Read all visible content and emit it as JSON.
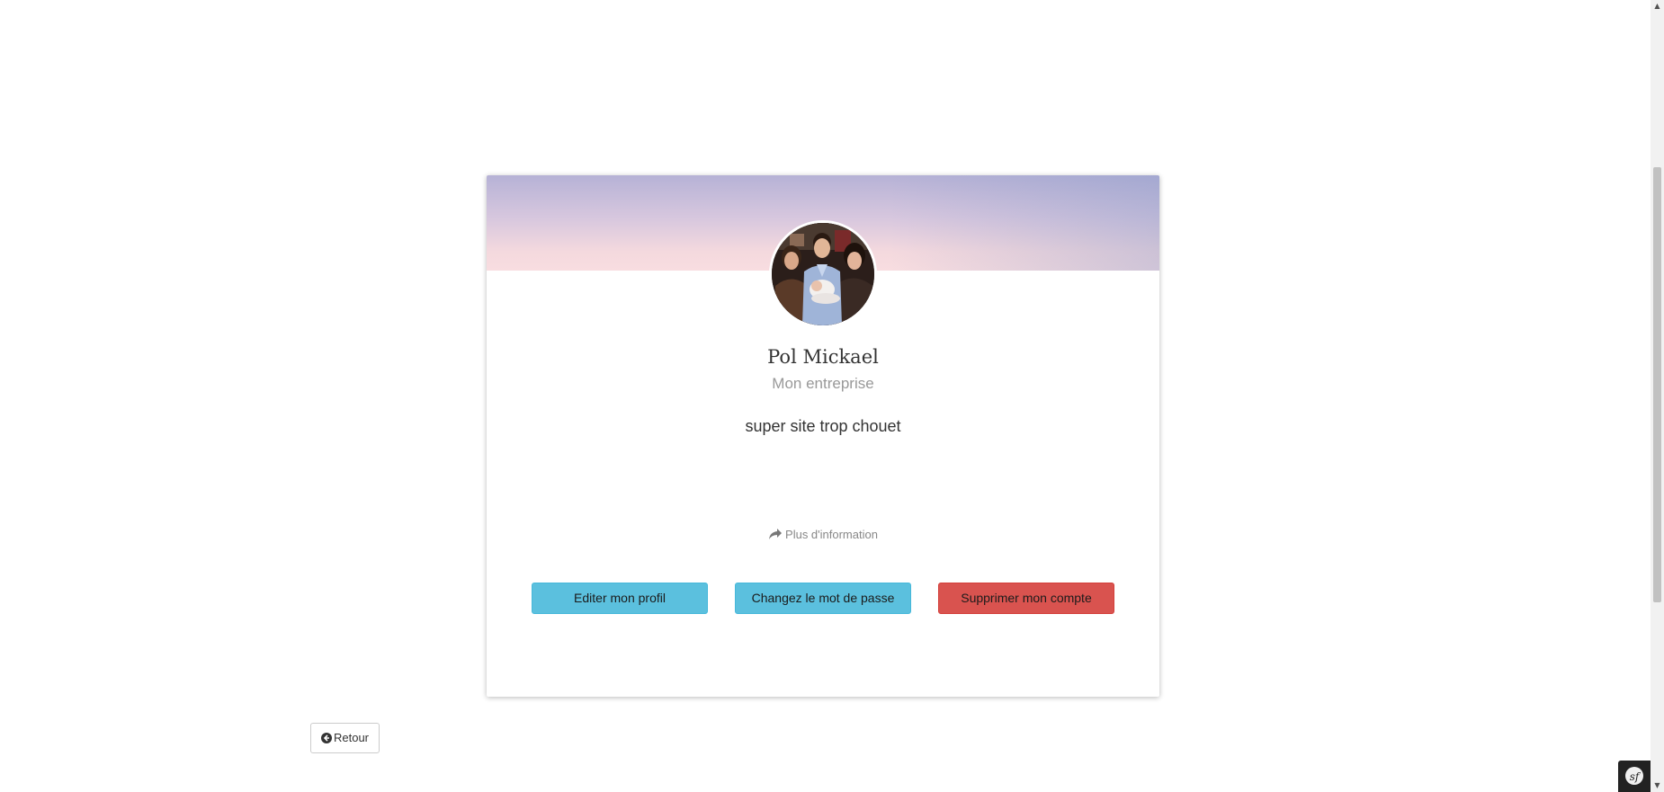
{
  "profile": {
    "name": "Pol Mickael",
    "company": "Mon entreprise",
    "bio": "super site trop chouet",
    "more_info_label": "Plus d'information"
  },
  "actions": {
    "edit_label": "Editer mon profil",
    "password_label": "Changez le mot de passe",
    "delete_label": "Supprimer mon compte"
  },
  "navigation": {
    "back_label": "Retour"
  },
  "icons": {
    "more_info": "share-icon",
    "back": "arrow-circle-left-icon",
    "debug_toolbar": "symfony-icon"
  },
  "colors": {
    "info_button": "#5bc0de",
    "danger_button": "#d9534f",
    "header_gradient_top": "#b6b2d6",
    "header_gradient_bottom": "#f8dde0"
  }
}
